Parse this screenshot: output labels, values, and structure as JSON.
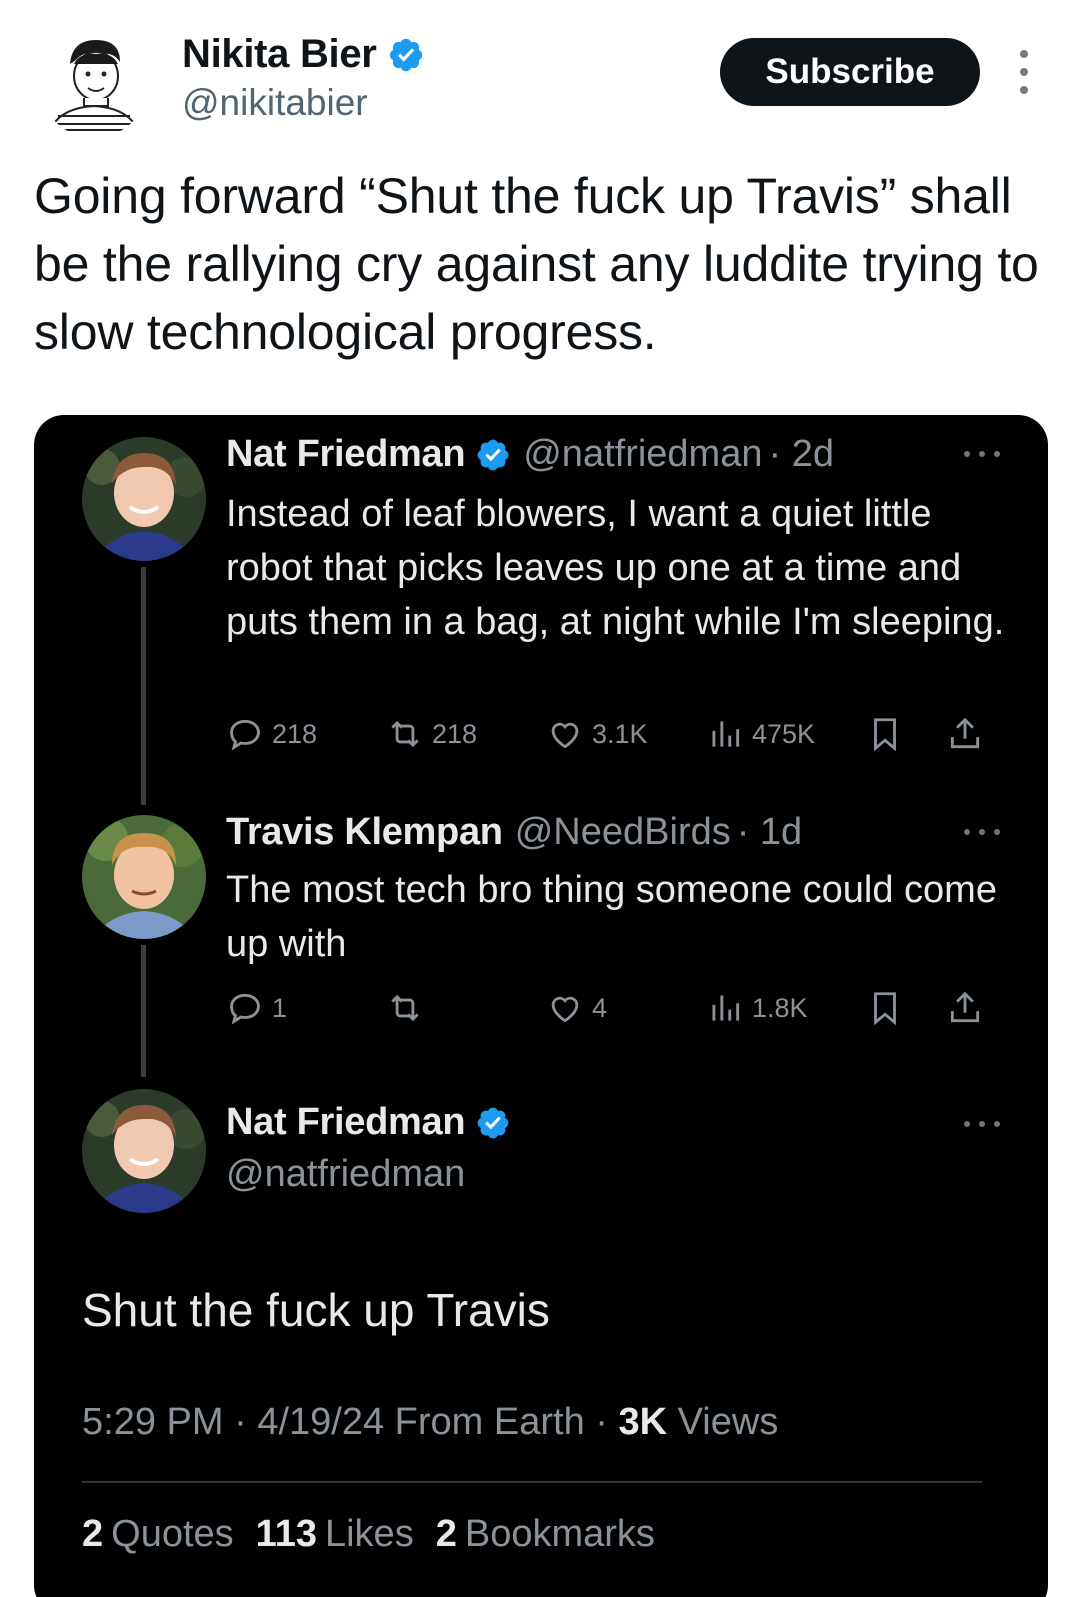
{
  "author": {
    "name": "Nikita Bier",
    "handle": "@nikitabier"
  },
  "header": {
    "subscribe_label": "Subscribe"
  },
  "tweet": {
    "text": "Going forward “Shut the fuck up Travis” shall be the rallying cry against any luddite trying to slow technological progress."
  },
  "embed": {
    "post1": {
      "name": "Nat Friedman",
      "handle": "@natfriedman",
      "time": "· 2d",
      "body": "Instead of leaf blowers, I want a quiet little robot that picks leaves up one at a time and puts them in a bag, at night while I'm sleeping.",
      "replies": "218",
      "reposts": "218",
      "likes": "3.1K",
      "views": "475K"
    },
    "post2": {
      "name": "Travis Klempan",
      "handle": "@NeedBirds",
      "time": "· 1d",
      "body": "The most tech bro thing someone could come up with",
      "replies": "1",
      "reposts": "",
      "likes": "4",
      "views": "1.8K"
    },
    "post3": {
      "name": "Nat Friedman",
      "handle": "@natfriedman",
      "body": "Shut the fuck up Travis",
      "time": "5:29 PM",
      "date": "4/19/24",
      "source": "From Earth",
      "views_count": "3K",
      "views_label": "Views",
      "quotes_count": "2",
      "quotes_label": "Quotes",
      "likes_count": "113",
      "likes_label": "Likes",
      "bookmarks_count": "2",
      "bookmarks_label": "Bookmarks"
    }
  },
  "colors": {
    "verified_blue": "#1d9bf0",
    "dark_bg": "#000000",
    "muted_text": "#8b9299"
  },
  "icons": [
    "verified-icon",
    "more-icon",
    "reply-icon",
    "repost-icon",
    "like-icon",
    "views-icon",
    "bookmark-icon",
    "share-icon"
  ]
}
